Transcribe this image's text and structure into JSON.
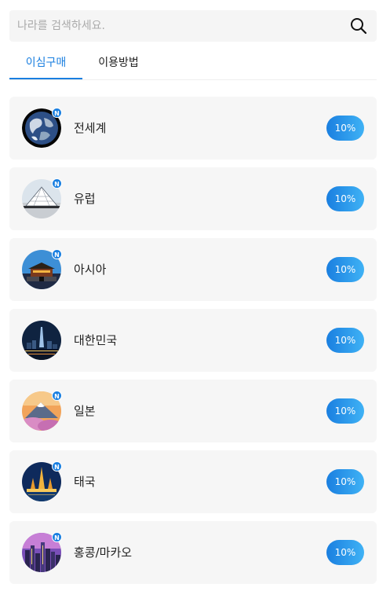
{
  "search": {
    "placeholder": "나라를 검색하세요.",
    "value": ""
  },
  "tabs": [
    {
      "label": "이심구매",
      "active": true
    },
    {
      "label": "이용방법",
      "active": false
    }
  ],
  "colors": {
    "accent": "#1a7fe0",
    "card_bg": "#f6f6f6",
    "badge": "#1a7fe0"
  },
  "new_badge_label": "N",
  "regions": [
    {
      "name": "전세계",
      "discount": "10%",
      "new": true,
      "icon": "globe-image"
    },
    {
      "name": "유럽",
      "discount": "10%",
      "new": true,
      "icon": "louvre-pyramid-image"
    },
    {
      "name": "아시아",
      "discount": "10%",
      "new": true,
      "icon": "palace-gate-image"
    },
    {
      "name": "대한민국",
      "discount": "10%",
      "new": false,
      "icon": "seoul-night-skyline-image"
    },
    {
      "name": "일본",
      "discount": "10%",
      "new": true,
      "icon": "mount-fuji-cherry-blossom-image"
    },
    {
      "name": "태국",
      "discount": "10%",
      "new": true,
      "icon": "thai-temple-night-image"
    },
    {
      "name": "홍콩/마카오",
      "discount": "10%",
      "new": true,
      "icon": "hongkong-skyline-image"
    }
  ]
}
